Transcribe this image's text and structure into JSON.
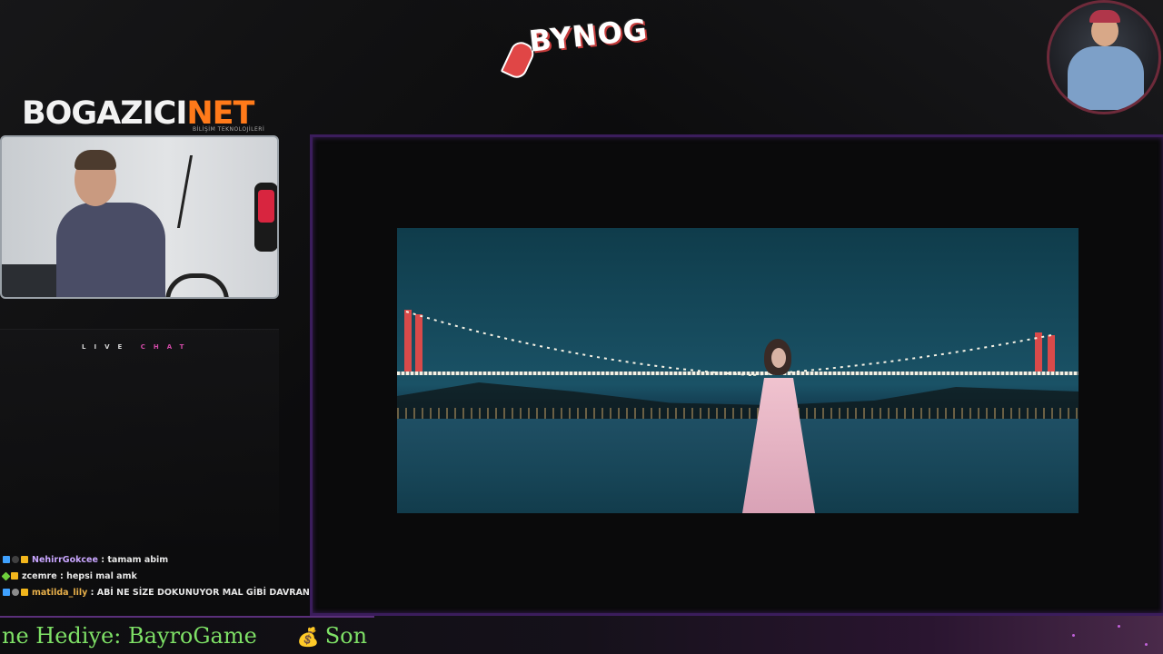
{
  "header": {
    "brand_logo_text": "BYNOG",
    "sponsor_logo_primary": "BOGAZICI",
    "sponsor_logo_accent": "NET",
    "sponsor_logo_sub": "BİLİŞİM TEKNOLOJİLERİ"
  },
  "live_chat": {
    "title_live": "LIVE",
    "title_chat": "CHAT",
    "messages": [
      {
        "user": "NehirrGokcee",
        "user_color": "#c9a6ff",
        "text": "tamam abim"
      },
      {
        "user": "zcemre",
        "user_color": "#e6e6e6",
        "text": "hepsi mal amk"
      },
      {
        "user": "matilda_lily",
        "user_color": "#e8b04a",
        "text": "ABİ NE SİZE DOKUNUYOR MAL GİBİ DAVRANIYOR BİZ DE MAL DİYOZ"
      }
    ]
  },
  "ticker": {
    "part1": "ne Hediye: BayroGame",
    "icon": "💰",
    "part2": "Son B"
  },
  "colors": {
    "accent_purple": "#3b1d5c",
    "ticker_green": "#7ee066",
    "sponsor_orange": "#ff7a1a"
  }
}
